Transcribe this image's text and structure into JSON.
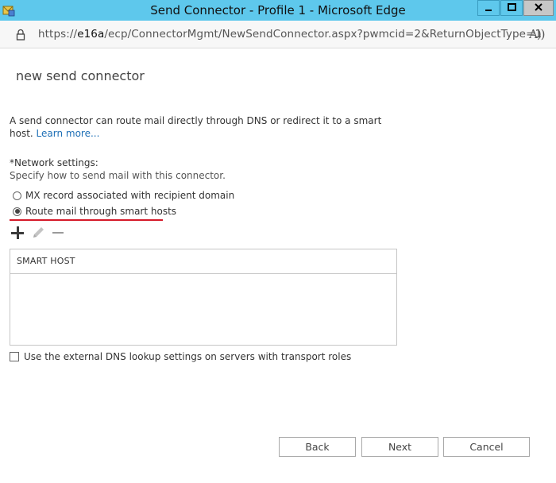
{
  "window": {
    "title": "Send Connector - Profile 1 - Microsoft Edge"
  },
  "address_bar": {
    "url_prefix": "https://",
    "url_host": "e16a",
    "url_path": "/ecp/ConnectorMgmt/NewSendConnector.aspx?pwmcid=2&ReturnObjectType=1",
    "read_aloud_icon": "A))"
  },
  "page": {
    "title": "new send connector",
    "description": "A send connector can route mail directly through DNS or redirect it to a smart host.",
    "learn_more": "Learn more...",
    "network_settings_label": "*Network settings:",
    "network_settings_help": "Specify how to send mail with this connector.",
    "radio_mx": "MX record associated with recipient domain",
    "radio_smart": "Route mail through smart hosts",
    "smart_host_column": "SMART HOST",
    "external_dns_label": "Use the external DNS lookup settings on servers with transport roles"
  },
  "state": {
    "selected_route": "smart-hosts",
    "external_dns_checked": false
  },
  "buttons": {
    "back": "Back",
    "next": "Next",
    "cancel": "Cancel"
  },
  "colors": {
    "titlebar": "#5ec8ec",
    "link": "#1e6fb6",
    "highlight_underline": "#d51a2a"
  },
  "icons": {
    "add": "plus-icon",
    "edit": "pencil-icon",
    "remove": "minus-icon"
  }
}
